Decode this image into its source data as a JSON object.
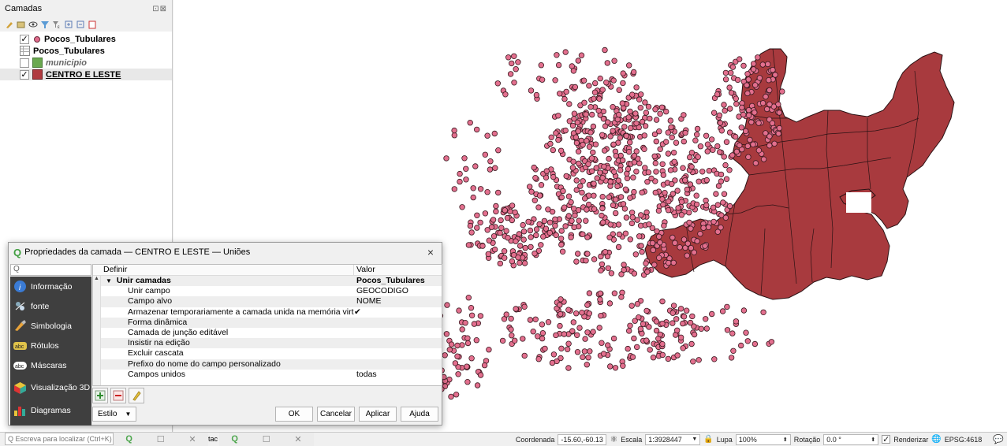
{
  "layers_panel": {
    "title": "Camadas",
    "header_controls": "⊡⊠",
    "layers": [
      {
        "name": "Pocos_Tubulares",
        "checked": "✓",
        "symbol": "point",
        "color": "#e06b8c"
      },
      {
        "name": "Pocos_Tubulares",
        "checked": "",
        "symbol": "table"
      },
      {
        "name": "municipio",
        "checked": "",
        "symbol": "fill",
        "color": "#6aa84f"
      },
      {
        "name": "CENTRO E LESTE",
        "checked": "✓",
        "symbol": "fill",
        "color": "#b0393f"
      }
    ]
  },
  "map": {
    "polygon_fill": "#a83a3e",
    "point_fill": "#e36f8e",
    "point_stroke": "#3a1a20"
  },
  "dialog": {
    "title": "Propriedades da camada — CENTRO E LESTE — Uniões",
    "close": "×",
    "search_placeholder": "Q",
    "nav": [
      {
        "label": "Informação",
        "icon": "info-icon"
      },
      {
        "label": "fonte",
        "icon": "source-icon"
      },
      {
        "label": "Simbologia",
        "icon": "symbology-icon"
      },
      {
        "label": "Rótulos",
        "icon": "labels-icon"
      },
      {
        "label": "Máscaras",
        "icon": "masks-icon"
      },
      {
        "label": "Visualização 3D",
        "icon": "3d-view-icon"
      },
      {
        "label": "Diagramas",
        "icon": "diagrams-icon"
      }
    ],
    "columns": {
      "definir": "Definir",
      "valor": "Valor"
    },
    "rows": [
      {
        "label": "Unir camadas",
        "value": "Pocos_Tubulares"
      },
      {
        "label": "Unir campo",
        "value": "GEOCODIGO"
      },
      {
        "label": "Campo alvo",
        "value": "NOME"
      },
      {
        "label": "Armazenar temporariamente a camada unida na memória virtual",
        "value": "✔"
      },
      {
        "label": "Forma dinâmica",
        "value": ""
      },
      {
        "label": "Camada de junção editável",
        "value": ""
      },
      {
        "label": "Insistir na edição",
        "value": ""
      },
      {
        "label": "Excluir cascata",
        "value": ""
      },
      {
        "label": "Prefixo do nome do campo personalizado",
        "value": ""
      },
      {
        "label": "Campos unidos",
        "value": "todas"
      }
    ],
    "estilo": "Estilo",
    "ok": "OK",
    "cancelar": "Cancelar",
    "aplicar": "Aplicar",
    "ajuda": "Ajuda"
  },
  "statusbar": {
    "locator_placeholder": "Q  Escreva para localizar (Ctrl+K)",
    "task_fragment": "tac",
    "coordenada_label": "Coordenada",
    "coordenada_value": "-15.60,-60.13",
    "escala_label": "Escala",
    "escala_value": "1:3928447",
    "lupa_label": "Lupa",
    "lupa_value": "100%",
    "rotacao_label": "Rotação",
    "rotacao_value": "0.0 °",
    "renderizar_label": "Renderizar",
    "crs": "EPSG:4618"
  }
}
